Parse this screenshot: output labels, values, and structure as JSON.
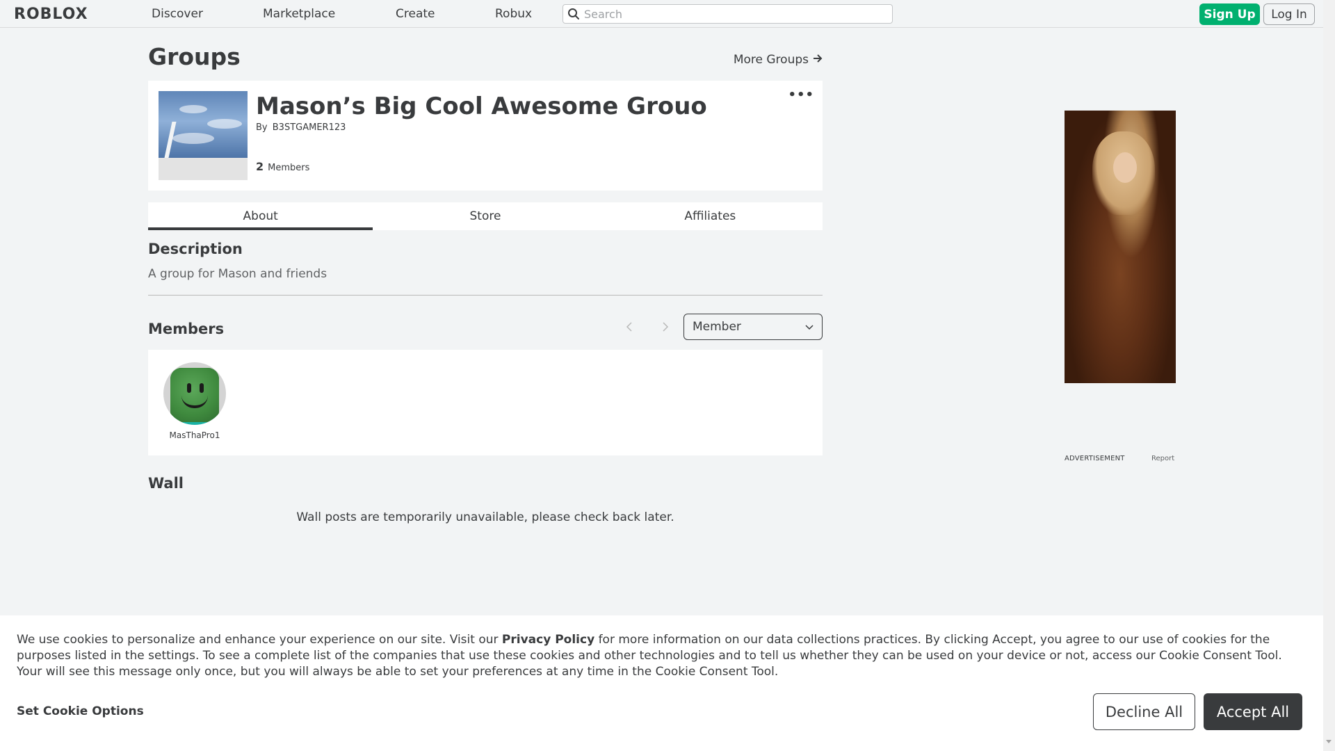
{
  "header": {
    "logo_text": "ROBLOX",
    "nav": [
      "Discover",
      "Marketplace",
      "Create",
      "Robux"
    ],
    "search_placeholder": "Search",
    "signup_label": "Sign Up",
    "login_label": "Log In",
    "icons": {
      "search": "search-icon"
    },
    "colors": {
      "signup_bg": "#00b06f"
    }
  },
  "page": {
    "title": "Groups",
    "more_groups": "More Groups",
    "more_groups_icon": "arrow-right-icon"
  },
  "group": {
    "name": "Mason’s Big Cool Awesome Grouo",
    "by_label": "By",
    "owner": "B3STGAMER123",
    "member_count": "2",
    "members_label": "Members",
    "more_menu": "•••"
  },
  "tabs": [
    {
      "label": "About",
      "active": true
    },
    {
      "label": "Store",
      "active": false
    },
    {
      "label": "Affiliates",
      "active": false
    }
  ],
  "description": {
    "title": "Description",
    "text": "A group for Mason and friends"
  },
  "members": {
    "title": "Members",
    "role_selected": "Member",
    "list": [
      {
        "name": "MasThaPro1"
      }
    ]
  },
  "wall": {
    "title": "Wall",
    "message": "Wall posts are temporarily unavailable, please check back later."
  },
  "ad": {
    "label": "ADVERTISEMENT",
    "report": "Report"
  },
  "cookie": {
    "text_before": "We use cookies to personalize and enhance your experience on our site. Visit our ",
    "privacy_policy": "Privacy Policy",
    "text_after": " for more information on our data collections practices. By clicking Accept, you agree to our use of cookies for the purposes listed in the settings. To see a complete list of the companies that use these cookies and other technologies and to tell us whether they can be used on your device or not, access our Cookie Consent Tool. Your will see this message only once, but you will always be able to set your preferences at any time in the Cookie Consent Tool.",
    "set_options": "Set Cookie Options",
    "decline": "Decline All",
    "accept": "Accept All"
  }
}
